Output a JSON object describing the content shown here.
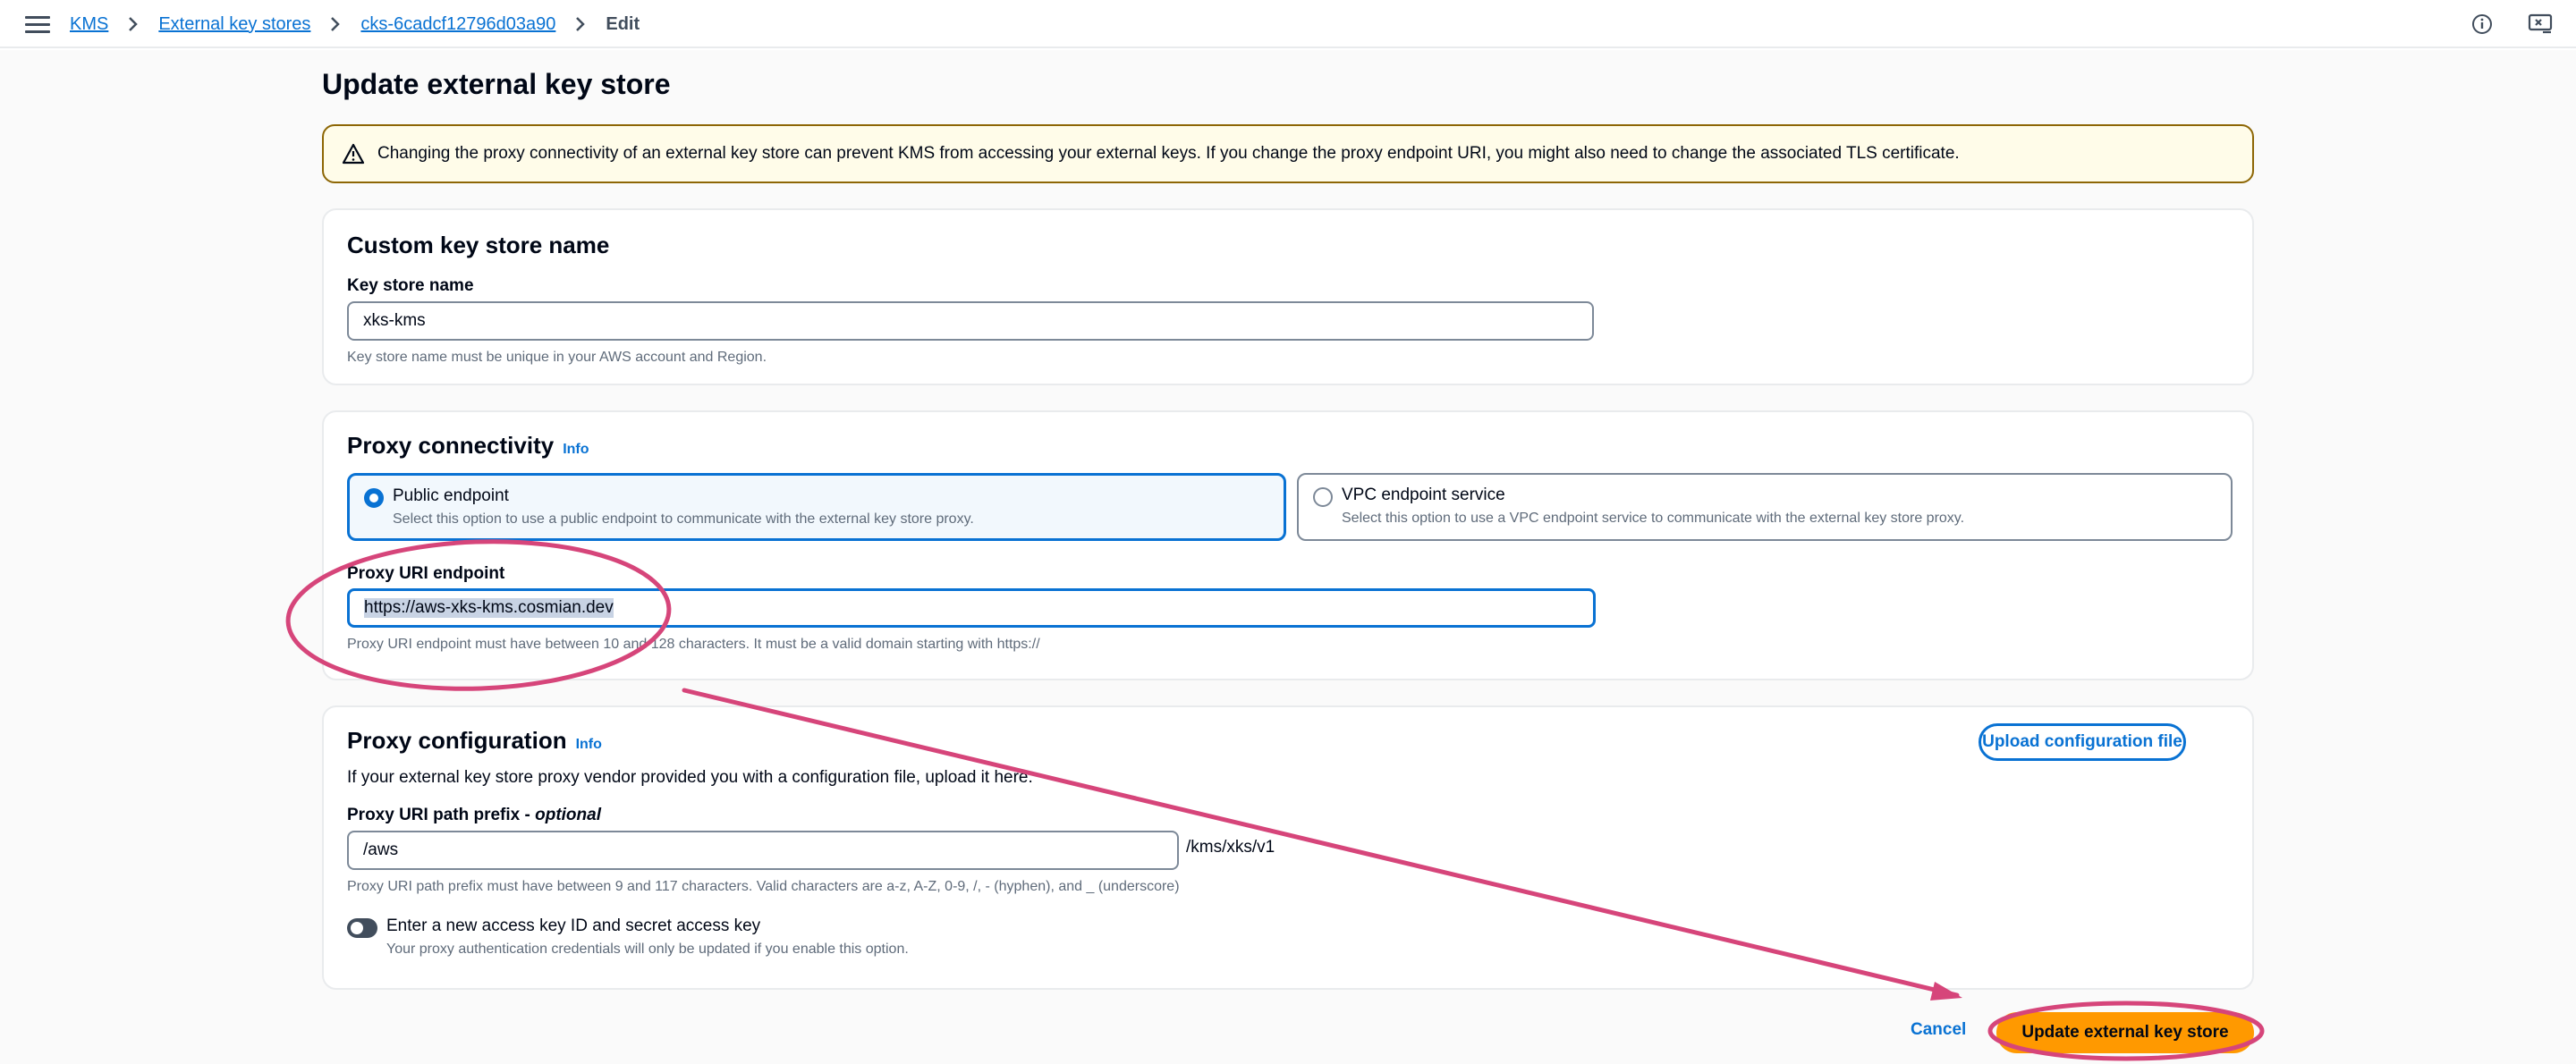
{
  "breadcrumbs": [
    {
      "label": "KMS"
    },
    {
      "label": "External key stores"
    },
    {
      "label": "cks-6cadcf12796d03a90"
    },
    {
      "label": "Edit"
    }
  ],
  "page_title": "Update external key store",
  "alert_text": "Changing the proxy connectivity of an external key store can prevent KMS from accessing your external keys. If you change the proxy endpoint URI, you might also need to change the associated TLS certificate.",
  "name_panel": {
    "title": "Custom key store name",
    "field_label": "Key store name",
    "field_value": "xks-kms",
    "help": "Key store name must be unique in your AWS account and Region."
  },
  "connectivity_panel": {
    "title": "Proxy connectivity",
    "info": "Info",
    "options": [
      {
        "title": "Public endpoint",
        "desc": "Select this option to use a public endpoint to communicate with the external key store proxy.",
        "selected": true
      },
      {
        "title": "VPC endpoint service",
        "desc": "Select this option to use a VPC endpoint service to communicate with the external key store proxy.",
        "selected": false
      }
    ],
    "uri_label": "Proxy URI endpoint",
    "uri_value": "https://aws-xks-kms.cosmian.dev",
    "uri_help": "Proxy URI endpoint must have between 10 and 128 characters. It must be a valid domain starting with https://"
  },
  "config_panel": {
    "title": "Proxy configuration",
    "info": "Info",
    "upload_button": "Upload configuration file",
    "desc": "If your external key store proxy vendor provided you with a configuration file, upload it here.",
    "prefix_label": "Proxy URI path prefix - ",
    "prefix_optional": "optional",
    "prefix_value": "/aws",
    "prefix_suffix": "/kms/xks/v1",
    "prefix_help": "Proxy URI path prefix must have between 9 and 117 characters. Valid characters are a-z, A-Z, 0-9, /, - (hyphen), and _ (underscore)",
    "toggle_label": "Enter a new access key ID and secret access key",
    "toggle_desc": "Your proxy authentication credentials will only be updated if you enable this option.",
    "toggle_on": false
  },
  "actions": {
    "cancel": "Cancel",
    "submit": "Update external key store"
  },
  "colors": {
    "link": "#0972d3",
    "primary": "#ff9900",
    "annotation": "#d6457a",
    "warning_border": "#8d6605"
  }
}
